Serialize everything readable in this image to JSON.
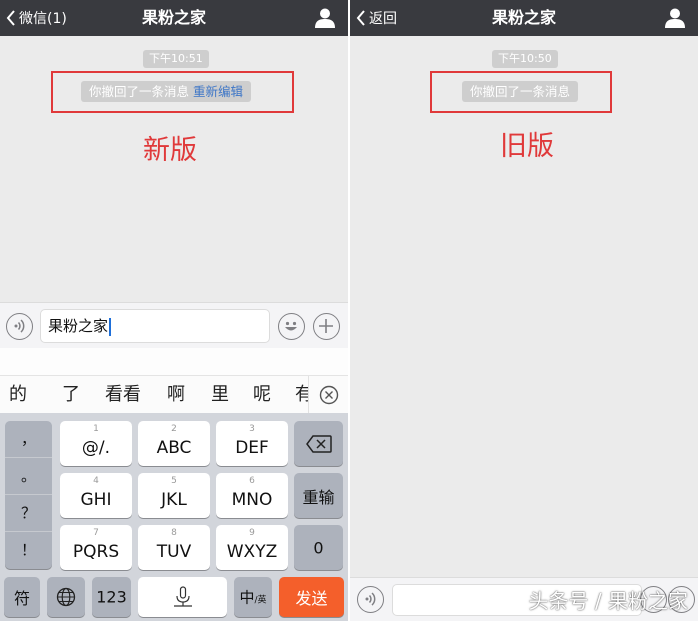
{
  "left": {
    "nav": {
      "back_label": "微信(1)",
      "title": "果粉之家"
    },
    "timestamp": "下午10:51",
    "recall_notice": "你撤回了一条消息",
    "reedit_link": "重新编辑",
    "caption": "新版",
    "input_text": "果粉之家",
    "candidates": [
      "的",
      "了",
      "看看",
      "啊",
      "里",
      "呢",
      "有"
    ],
    "keyboard": {
      "punctuation": [
        "，",
        "。",
        "？",
        "！"
      ],
      "keys": [
        {
          "num": "1",
          "letters": "@/."
        },
        {
          "num": "2",
          "letters": "ABC"
        },
        {
          "num": "3",
          "letters": "DEF"
        },
        {
          "num": "4",
          "letters": "GHI"
        },
        {
          "num": "5",
          "letters": "JKL"
        },
        {
          "num": "6",
          "letters": "MNO"
        },
        {
          "num": "7",
          "letters": "PQRS"
        },
        {
          "num": "8",
          "letters": "TUV"
        },
        {
          "num": "9",
          "letters": "WXYZ"
        }
      ],
      "reenter_label": "重输",
      "zero_label": "0",
      "symbol_label": "符",
      "numeric_label": "123",
      "lang_label": "中",
      "lang_sub_label": "/英",
      "send_label": "发送"
    }
  },
  "right": {
    "nav": {
      "back_label": "返回",
      "title": "果粉之家"
    },
    "timestamp": "下午10:50",
    "recall_notice": "你撤回了一条消息",
    "caption": "旧版"
  },
  "watermark": "头条号 / 果粉之家",
  "icons": {
    "back": "chevron-left-icon",
    "user": "user-icon",
    "voice": "voice-icon",
    "emoji": "emoji-icon",
    "add": "plus-icon",
    "close": "close-circle-icon",
    "backspace": "backspace-icon",
    "globe": "globe-icon",
    "mic": "microphone-icon"
  },
  "colors": {
    "nav_bg": "#393a3f",
    "chat_bg": "#ebebeb",
    "highlight_red": "#e0393a",
    "link_blue": "#3d76c7",
    "send_orange": "#f45f2b"
  }
}
